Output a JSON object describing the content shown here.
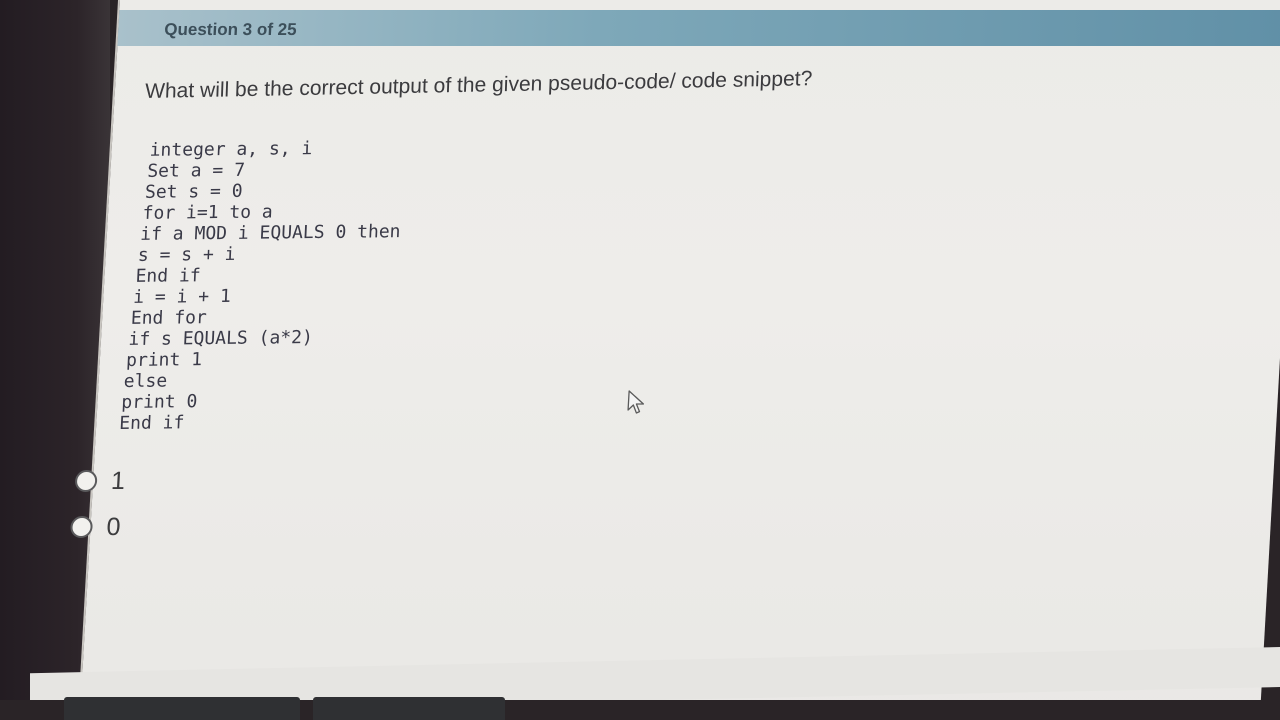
{
  "header": {
    "question_counter": "Question 3 of 25"
  },
  "question": {
    "text": "What will be the correct output of the given pseudo-code/ code snippet?"
  },
  "code": {
    "lines": [
      "integer a, s, i",
      "Set a = 7",
      "Set s = 0",
      "for i=1 to a",
      "if a MOD i EQUALS 0 then",
      "s = s + i",
      "End if",
      "i = i + 1",
      "End for",
      "if s EQUALS (a*2)",
      "print 1",
      "else",
      "print 0",
      "End if"
    ]
  },
  "options": [
    {
      "label": "1",
      "selected": false
    },
    {
      "label": "0",
      "selected": false
    }
  ],
  "colors": {
    "header_bar": "#5f8fa6",
    "keyword": "#5a5fb8",
    "text": "#3b3b3e"
  },
  "icons": {
    "cursor": "mouse-pointer-icon"
  }
}
